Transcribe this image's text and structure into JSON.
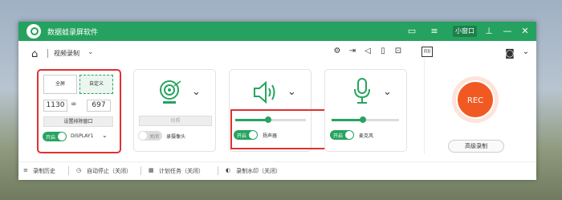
{
  "app": {
    "title": "数据蛙录屏软件"
  },
  "titlebar": {
    "mini_window_label": "小窗口"
  },
  "toolbar": {
    "mode": "视频录制"
  },
  "screen_card": {
    "fullscreen_label": "全屏",
    "custom_label": "自定义",
    "width": "1130",
    "height": "697",
    "exclude_window_label": "设置排除窗口",
    "toggle_label": "开启",
    "display": "DISPLAY1"
  },
  "camera_card": {
    "capture_label": "拍照",
    "toggle_label": "关闭",
    "name": "录摄像头"
  },
  "speaker_card": {
    "toggle_label": "开启",
    "name": "扬声器",
    "volume": 0.45
  },
  "mic_card": {
    "toggle_label": "开启",
    "name": "麦克风",
    "volume": 0.45
  },
  "rec": {
    "label": "REC",
    "advanced_label": "高级录制"
  },
  "bottom": {
    "history": "录制历史",
    "auto_stop": "自动停止（关闭）",
    "schedule": "计划任务（关闭）",
    "watermark": "录制水印（关闭）"
  },
  "colors": {
    "brand": "#25a25f",
    "rec": "#f05a22",
    "highlight": "#e03131"
  }
}
